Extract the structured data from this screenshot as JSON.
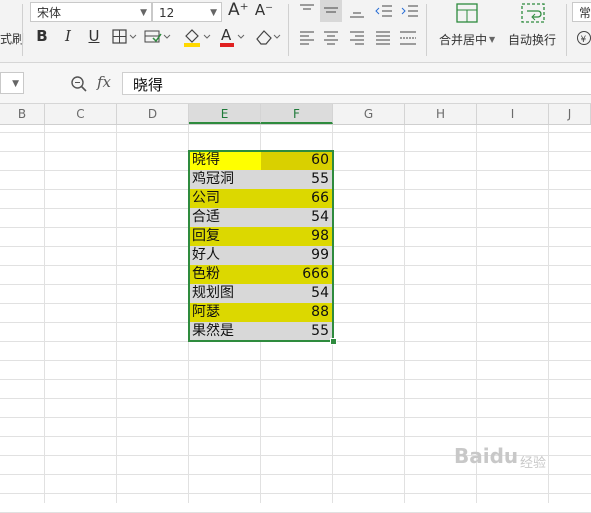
{
  "toolbar": {
    "font_name": "宋体",
    "font_size": "12",
    "increase_font": "A⁺",
    "decrease_font": "A⁻",
    "bold": "B",
    "italic": "I",
    "underline": "U",
    "format_painter_label": "式刷",
    "merge_center_label": "合并居中",
    "wrap_text_label": "自动换行",
    "number_format_partial": "常"
  },
  "formula_bar": {
    "name_box_value": "",
    "fx_label": "fx",
    "formula_value": "晓得"
  },
  "columns": [
    "B",
    "C",
    "D",
    "E",
    "F",
    "G",
    "H",
    "I",
    "J"
  ],
  "selected_columns": [
    "E",
    "F"
  ],
  "rows": [
    {
      "text": "晓得",
      "value": "60"
    },
    {
      "text": "鸡冠洞",
      "value": "55"
    },
    {
      "text": "公司",
      "value": "66"
    },
    {
      "text": "合适",
      "value": "54"
    },
    {
      "text": "回复",
      "value": "98"
    },
    {
      "text": "好人",
      "value": "99"
    },
    {
      "text": "色粉",
      "value": "666"
    },
    {
      "text": "规划图",
      "value": "54"
    },
    {
      "text": "阿瑟",
      "value": "88"
    },
    {
      "text": "果然是",
      "value": "55"
    }
  ],
  "colors": {
    "active_text_fill": "#ffff00",
    "active_value_fill": "#d9d000",
    "band_yellow": "#dcd800",
    "band_gray": "#d8d8d8",
    "selection_border": "#2e8b3e"
  },
  "watermark": {
    "text": "Baidu",
    "suffix": "经验"
  }
}
